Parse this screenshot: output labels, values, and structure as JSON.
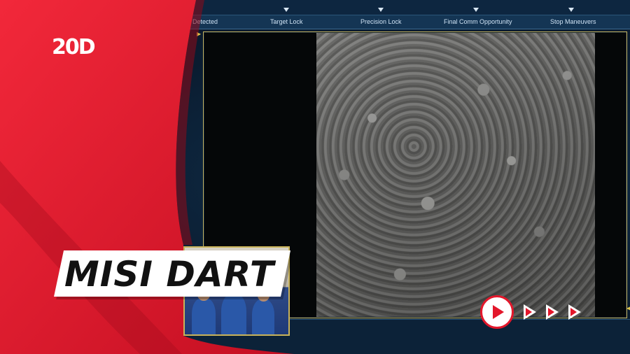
{
  "timeline": {
    "labels": [
      "s Detected",
      "Target Lock",
      "Precision Lock",
      "Final Comm Opportunity",
      "Stop Maneuvers"
    ]
  },
  "logo": {
    "text": "20D"
  },
  "title": {
    "text": "MISI DART"
  },
  "colors": {
    "brand_red": "#e3172b",
    "frame_gold": "#c9b35a",
    "panel_blue": "#143554"
  },
  "icons": {
    "play": "play-icon",
    "forward": "forward-chevron-icon"
  }
}
